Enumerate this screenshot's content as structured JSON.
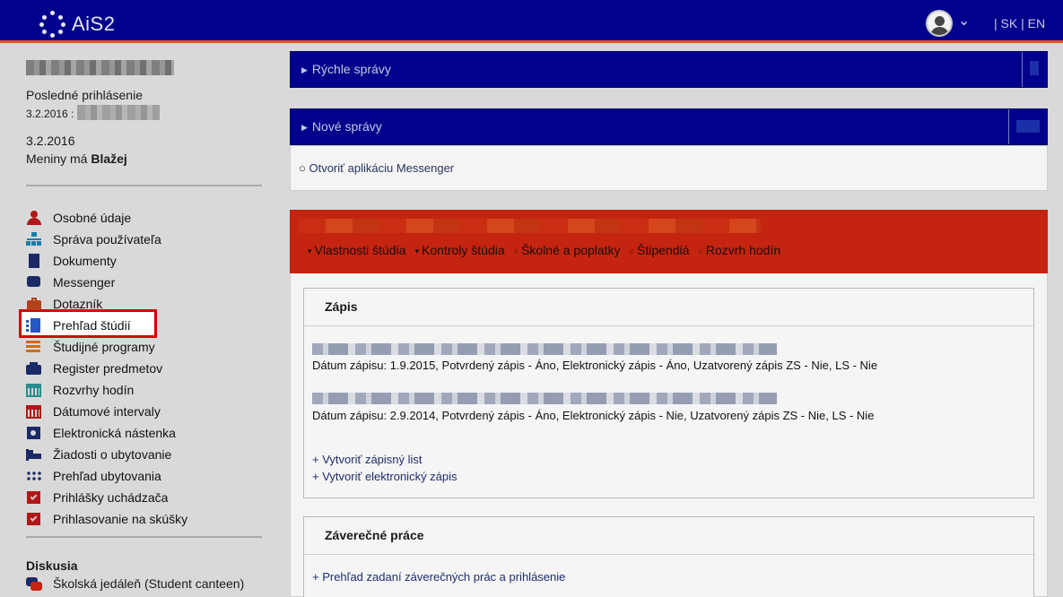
{
  "header": {
    "logo_text": "AiS2",
    "lang_sk": "SK",
    "lang_en": "EN",
    "lang_sep": "|"
  },
  "sidebar": {
    "last_login_label": "Posledné prihlásenie",
    "last_login_date": "3.2.2016 :",
    "today_date": "3.2.2016",
    "nameday_prefix": "Meniny má",
    "nameday_name": "Blažej",
    "menu": [
      {
        "label": "Osobné údaje",
        "icon": "person-icon",
        "color": "#b01818"
      },
      {
        "label": "Správa používateľa",
        "icon": "org-chart-icon",
        "color": "#1b7fa8"
      },
      {
        "label": "Dokumenty",
        "icon": "document-icon",
        "color": "#1a2a66"
      },
      {
        "label": "Messenger",
        "icon": "chat-icon",
        "color": "#1a2a66"
      },
      {
        "label": "Dotazník",
        "icon": "briefcase-icon",
        "color": "#b3421a"
      },
      {
        "label": "Prehľad štúdií",
        "icon": "studies-icon",
        "color": "#2457c7"
      },
      {
        "label": "Študijné programy",
        "icon": "list-icon",
        "color": "#c9701a"
      },
      {
        "label": "Register predmetov",
        "icon": "folder-icon",
        "color": "#1a2a66"
      },
      {
        "label": "Rozvrhy hodín",
        "icon": "calendar-icon",
        "color": "#2a8c8c"
      },
      {
        "label": "Dátumové intervaly",
        "icon": "calendar-red-icon",
        "color": "#b01818"
      },
      {
        "label": "Elektronická nástenka",
        "icon": "noticeboard-icon",
        "color": "#1a2a66"
      },
      {
        "label": "Žiadosti o ubytovanie",
        "icon": "bed-icon",
        "color": "#1a2a66"
      },
      {
        "label": "Prehľad ubytovania",
        "icon": "grid-dots-icon",
        "color": "#1a2a66"
      },
      {
        "label": "Prihlášky uchádzača",
        "icon": "checkbox-icon",
        "color": "#b01818"
      },
      {
        "label": "Prihlasovanie na skúšky",
        "icon": "checkbox-icon",
        "color": "#b01818"
      }
    ],
    "section_title": "Diskusia",
    "canteen_label": "Školská jedáleň (Student canteen)"
  },
  "panels": {
    "quick_messages": "Rýchle správy",
    "new_messages": "Nové správy",
    "messenger_link": "Otvoriť aplikáciu Messenger"
  },
  "study": {
    "links": [
      {
        "prefix": "▾",
        "label": "Vlastnosti štúdia"
      },
      {
        "prefix": "▾",
        "label": "Kontroly štúdia"
      },
      {
        "prefix": "○",
        "label": "Školné a poplatky"
      },
      {
        "prefix": "○",
        "label": "Štipendiá"
      },
      {
        "prefix": "○",
        "label": "Rozvrh hodín"
      }
    ]
  },
  "enrollment": {
    "title": "Zápis",
    "rows": [
      "Dátum zápisu: 1.9.2015, Potvrdený zápis - Áno, Elektronický zápis - Áno, Uzatvorený zápis ZS - Nie, LS - Nie",
      "Dátum zápisu: 2.9.2014, Potvrdený zápis - Áno, Elektronický zápis - Nie, Uzatvorený zápis ZS - Nie, LS - Nie"
    ],
    "create_sheet": "+ Vytvoriť zápisný list",
    "create_electronic": "+ Vytvoriť elektronický zápis"
  },
  "thesis": {
    "title": "Záverečné práce",
    "link": "+ Prehľad zadaní záverečných prác a prihlásenie"
  },
  "colors": {
    "topbar": "#01018c",
    "accent_orange": "#e8551f",
    "study_red": "#c42410",
    "highlight_red": "#d60000"
  }
}
